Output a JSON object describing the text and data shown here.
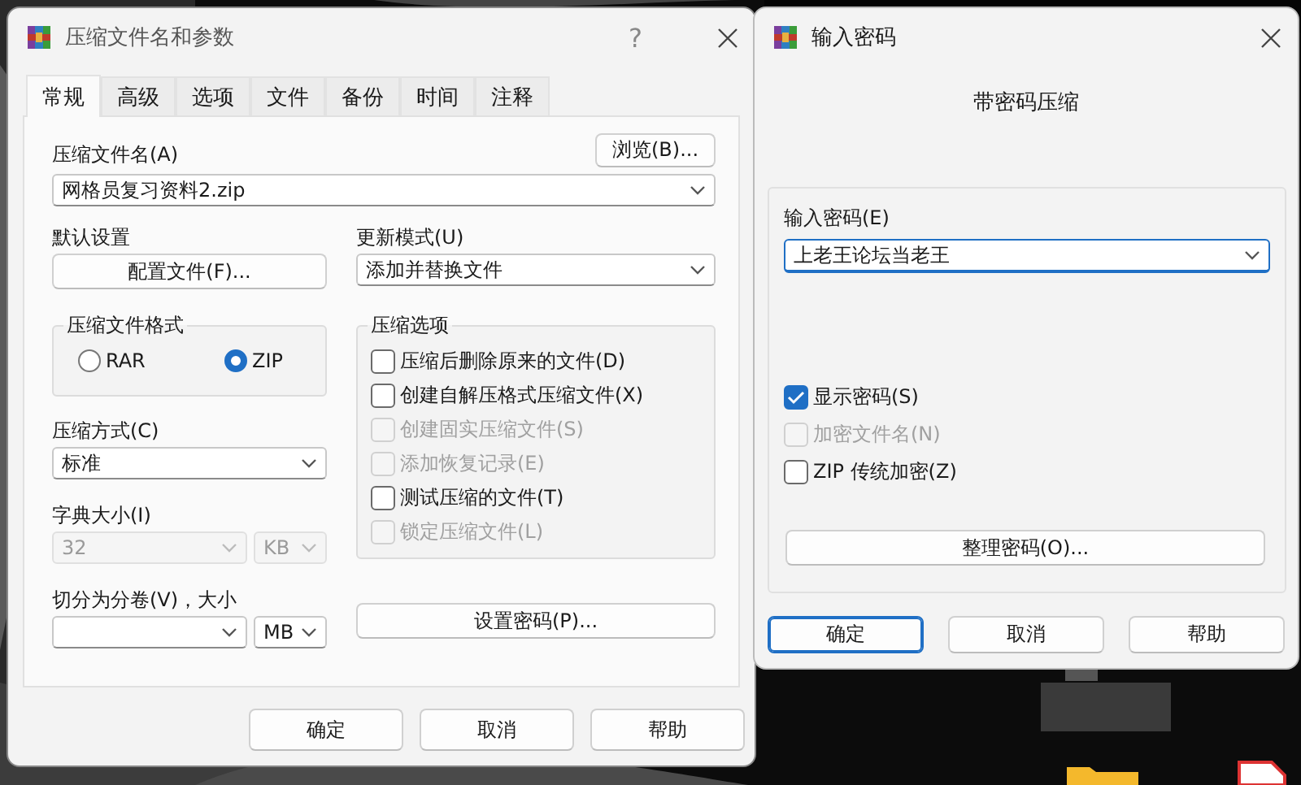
{
  "archive_dialog": {
    "title": "压缩文件名和参数",
    "help_button": "?",
    "tabs": [
      {
        "label": "常规",
        "selected": true
      },
      {
        "label": "高级",
        "selected": false
      },
      {
        "label": "选项",
        "selected": false
      },
      {
        "label": "文件",
        "selected": false
      },
      {
        "label": "备份",
        "selected": false
      },
      {
        "label": "时间",
        "selected": false
      },
      {
        "label": "注释",
        "selected": false
      }
    ],
    "archive_name": {
      "label": "压缩文件名(A)",
      "value": "网格员复习资料2.zip"
    },
    "browse_button": "浏览(B)...",
    "default_settings": {
      "label": "默认设置",
      "button": "配置文件(F)..."
    },
    "update_mode": {
      "label": "更新模式(U)",
      "value": "添加并替换文件"
    },
    "format": {
      "label": "压缩文件格式",
      "options": [
        {
          "label": "RAR",
          "selected": false
        },
        {
          "label": "ZIP",
          "selected": true
        }
      ]
    },
    "method": {
      "label": "压缩方式(C)",
      "value": "标准"
    },
    "dictionary": {
      "label": "字典大小(I)",
      "value": "32",
      "unit": "KB",
      "disabled": true
    },
    "split": {
      "label": "切分为分卷(V)，大小",
      "unit": "MB"
    },
    "options": {
      "label": "压缩选项",
      "items": [
        {
          "label": "压缩后删除原来的文件(D)",
          "checked": false,
          "disabled": false
        },
        {
          "label": "创建自解压格式压缩文件(X)",
          "checked": false,
          "disabled": false
        },
        {
          "label": "创建固实压缩文件(S)",
          "checked": false,
          "disabled": true
        },
        {
          "label": "添加恢复记录(E)",
          "checked": false,
          "disabled": true
        },
        {
          "label": "测试压缩的文件(T)",
          "checked": false,
          "disabled": false
        },
        {
          "label": "锁定压缩文件(L)",
          "checked": false,
          "disabled": true
        }
      ]
    },
    "password_button": "设置密码(P)...",
    "buttons": [
      {
        "label": "确定",
        "default": false
      },
      {
        "label": "取消",
        "default": false
      },
      {
        "label": "帮助",
        "default": false
      }
    ]
  },
  "password_dialog": {
    "title": "输入密码",
    "heading": "带密码压缩",
    "password": {
      "label": "输入密码(E)",
      "value": "上老王论坛当老王",
      "focused": true
    },
    "options": [
      {
        "label": "显示密码(S)",
        "checked": true,
        "disabled": false
      },
      {
        "label": "加密文件名(N)",
        "checked": false,
        "disabled": true
      },
      {
        "label": "ZIP 传统加密(Z)",
        "checked": false,
        "disabled": false
      }
    ],
    "organize_button": "整理密码(O)...",
    "buttons": [
      {
        "label": "确定",
        "default": true
      },
      {
        "label": "取消",
        "default": false
      },
      {
        "label": "帮助",
        "default": false
      }
    ]
  }
}
